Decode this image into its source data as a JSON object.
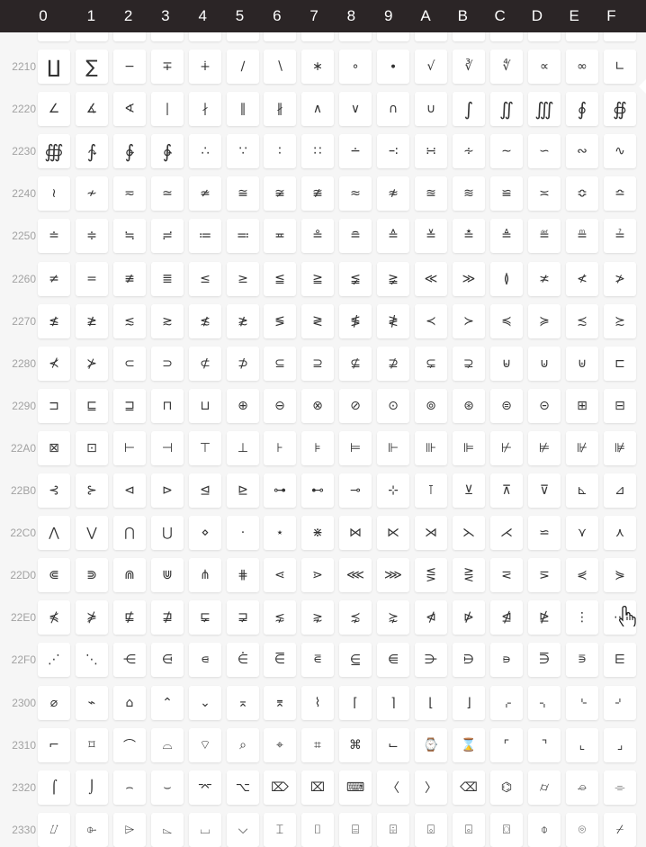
{
  "columns": [
    "0",
    "1",
    "2",
    "3",
    "4",
    "5",
    "6",
    "7",
    "8",
    "9",
    "A",
    "B",
    "C",
    "D",
    "E",
    "F"
  ],
  "rows": [
    {
      "label": "",
      "glyphs": [
        "",
        "",
        "",
        "",
        "",
        "",
        "",
        "",
        "",
        "",
        "",
        "",
        "",
        "",
        "",
        "∯"
      ]
    },
    {
      "label": "2210",
      "glyphs": [
        "∐",
        "∑",
        "−",
        "∓",
        "∔",
        "∕",
        "∖",
        "∗",
        "∘",
        "∙",
        "√",
        "∛",
        "∜",
        "∝",
        "∞",
        "∟"
      ]
    },
    {
      "label": "2220",
      "glyphs": [
        "∠",
        "∡",
        "∢",
        "∣",
        "∤",
        "∥",
        "∦",
        "∧",
        "∨",
        "∩",
        "∪",
        "∫",
        "∬",
        "∭",
        "∮",
        "∯"
      ]
    },
    {
      "label": "2230",
      "glyphs": [
        "∰",
        "∱",
        "∲",
        "∳",
        "∴",
        "∵",
        "∶",
        "∷",
        "∸",
        "∹",
        "∺",
        "∻",
        "∼",
        "∽",
        "∾",
        "∿"
      ]
    },
    {
      "label": "2240",
      "glyphs": [
        "≀",
        "≁",
        "≂",
        "≃",
        "≄",
        "≅",
        "≆",
        "≇",
        "≈",
        "≉",
        "≊",
        "≋",
        "≌",
        "≍",
        "≎",
        "≏"
      ]
    },
    {
      "label": "2250",
      "glyphs": [
        "≐",
        "≑",
        "≒",
        "≓",
        "≔",
        "≕",
        "≖",
        "≗",
        "≘",
        "≙",
        "≚",
        "≛",
        "≜",
        "≝",
        "≞",
        "≟"
      ]
    },
    {
      "label": "2260",
      "glyphs": [
        "≠",
        "=",
        "≢",
        "≣",
        "≤",
        "≥",
        "≦",
        "≧",
        "≨",
        "≩",
        "≪",
        "≫",
        "≬",
        "≭",
        "≮",
        "≯"
      ]
    },
    {
      "label": "2270",
      "glyphs": [
        "≰",
        "≱",
        "≲",
        "≳",
        "≴",
        "≵",
        "≶",
        "≷",
        "≸",
        "≹",
        "≺",
        "≻",
        "≼",
        "≽",
        "≾",
        "≿"
      ]
    },
    {
      "label": "2280",
      "glyphs": [
        "⊀",
        "⊁",
        "⊂",
        "⊃",
        "⊄",
        "⊅",
        "⊆",
        "⊇",
        "⊈",
        "⊉",
        "⊊",
        "⊋",
        "⊌",
        "⊍",
        "⊎",
        "⊏"
      ]
    },
    {
      "label": "2290",
      "glyphs": [
        "⊐",
        "⊑",
        "⊒",
        "⊓",
        "⊔",
        "⊕",
        "⊖",
        "⊗",
        "⊘",
        "⊙",
        "⊚",
        "⊛",
        "⊜",
        "⊝",
        "⊞",
        "⊟"
      ]
    },
    {
      "label": "22A0",
      "glyphs": [
        "⊠",
        "⊡",
        "⊢",
        "⊣",
        "⊤",
        "⊥",
        "⊦",
        "⊧",
        "⊨",
        "⊩",
        "⊪",
        "⊫",
        "⊬",
        "⊭",
        "⊮",
        "⊯"
      ]
    },
    {
      "label": "22B0",
      "glyphs": [
        "⊰",
        "⊱",
        "⊲",
        "⊳",
        "⊴",
        "⊵",
        "⊶",
        "⊷",
        "⊸",
        "⊹",
        "⊺",
        "⊻",
        "⊼",
        "⊽",
        "⊾",
        "⊿"
      ]
    },
    {
      "label": "22C0",
      "glyphs": [
        "⋀",
        "⋁",
        "⋂",
        "⋃",
        "⋄",
        "⋅",
        "⋆",
        "⋇",
        "⋈",
        "⋉",
        "⋊",
        "⋋",
        "⋌",
        "⋍",
        "⋎",
        "⋏"
      ]
    },
    {
      "label": "22D0",
      "glyphs": [
        "⋐",
        "⋑",
        "⋒",
        "⋓",
        "⋔",
        "⋕",
        "⋖",
        "⋗",
        "⋘",
        "⋙",
        "⋚",
        "⋛",
        "⋜",
        "⋝",
        "⋞",
        "⋟"
      ]
    },
    {
      "label": "22E0",
      "glyphs": [
        "⋠",
        "⋡",
        "⋢",
        "⋣",
        "⋤",
        "⋥",
        "⋦",
        "⋧",
        "⋨",
        "⋩",
        "⋪",
        "⋫",
        "⋬",
        "⋭",
        "⋮",
        "⋯"
      ]
    },
    {
      "label": "22F0",
      "glyphs": [
        "⋰",
        "⋱",
        "⋲",
        "⋳",
        "⋴",
        "⋵",
        "⋶",
        "⋷",
        "⋸",
        "⋹",
        "⋺",
        "⋻",
        "⋼",
        "⋽",
        "⋾",
        "⋿"
      ]
    },
    {
      "label": "2300",
      "glyphs": [
        "⌀",
        "⌁",
        "⌂",
        "⌃",
        "⌄",
        "⌅",
        "⌆",
        "⌇",
        "⌈",
        "⌉",
        "⌊",
        "⌋",
        "⌌",
        "⌍",
        "⌎",
        "⌏"
      ]
    },
    {
      "label": "2310",
      "glyphs": [
        "⌐",
        "⌑",
        "⌒",
        "⌓",
        "⌔",
        "⌕",
        "⌖",
        "⌗",
        "⌘",
        "⌙",
        "⌚",
        "⌛",
        "⌜",
        "⌝",
        "⌞",
        "⌟"
      ]
    },
    {
      "label": "2320",
      "glyphs": [
        "⌠",
        "⌡",
        "⌢",
        "⌣",
        "⌤",
        "⌥",
        "⌦",
        "⌧",
        "⌨",
        "〈",
        "〉",
        "⌫",
        "⌬",
        "⌭",
        "⌮",
        "⌯"
      ]
    },
    {
      "label": "2330",
      "glyphs": [
        "⌰",
        "⌱",
        "⌲",
        "⌳",
        "⌴",
        "⌵",
        "⌶",
        "⌷",
        "⌸",
        "⌹",
        "⌺",
        "⌻",
        "⌼",
        "⌽",
        "⌾",
        "⌿"
      ]
    }
  ],
  "colors": {
    "header_bg": "#2b2526",
    "header_text": "#ffffff",
    "cell_bg": "#ffffff",
    "page_bg": "#f6f6f6",
    "row_label": "#a2a2a2"
  },
  "icons": {
    "cursor": "hand-pointer-icon"
  }
}
